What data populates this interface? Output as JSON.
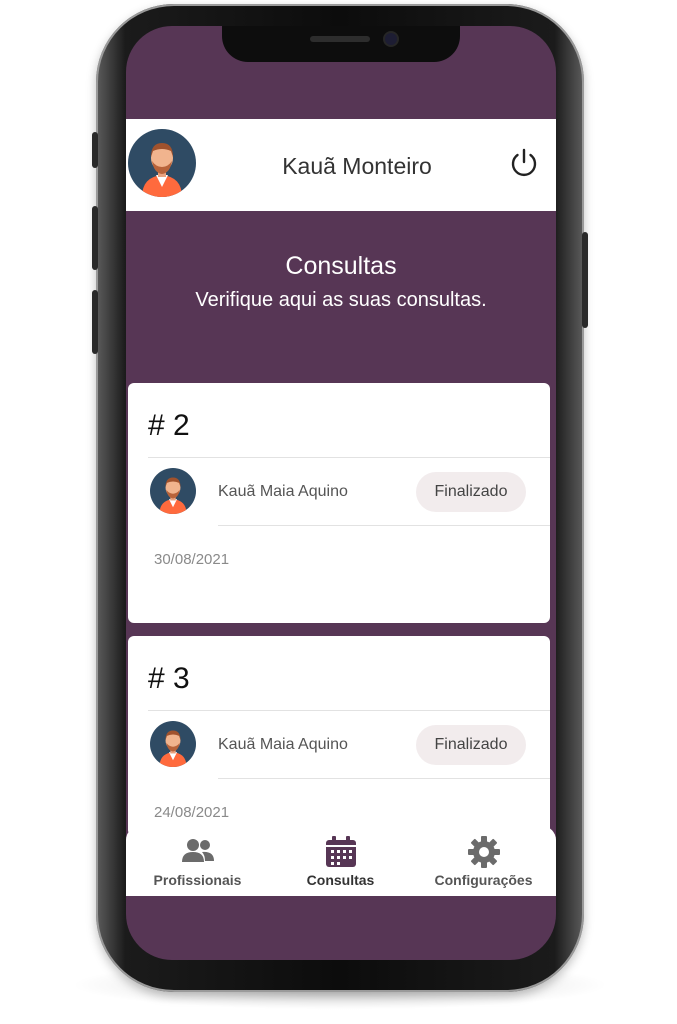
{
  "header": {
    "user_name": "Kauã Monteiro",
    "avatar_icon": "user-avatar-icon",
    "logout_icon": "power-icon"
  },
  "intro": {
    "title": "Consultas",
    "subtitle": "Verifique aqui as suas consultas."
  },
  "appointments": [
    {
      "number": "# 2",
      "professional": "Kauã Maia Aquino",
      "status": "Finalizado",
      "date": "30/08/2021"
    },
    {
      "number": "# 3",
      "professional": "Kauã Maia Aquino",
      "status": "Finalizado",
      "date": "24/08/2021"
    }
  ],
  "bottom_nav": {
    "items": [
      {
        "label": "Profissionais",
        "icon": "users-icon",
        "active": false
      },
      {
        "label": "Consultas",
        "icon": "calendar-icon",
        "active": true
      },
      {
        "label": "Configurações",
        "icon": "gear-icon",
        "active": false
      }
    ]
  },
  "colors": {
    "brand": "#573655",
    "accent_active": "#573655",
    "inactive": "#666666",
    "card": "#ffffff",
    "badge_bg": "#f2eced"
  }
}
